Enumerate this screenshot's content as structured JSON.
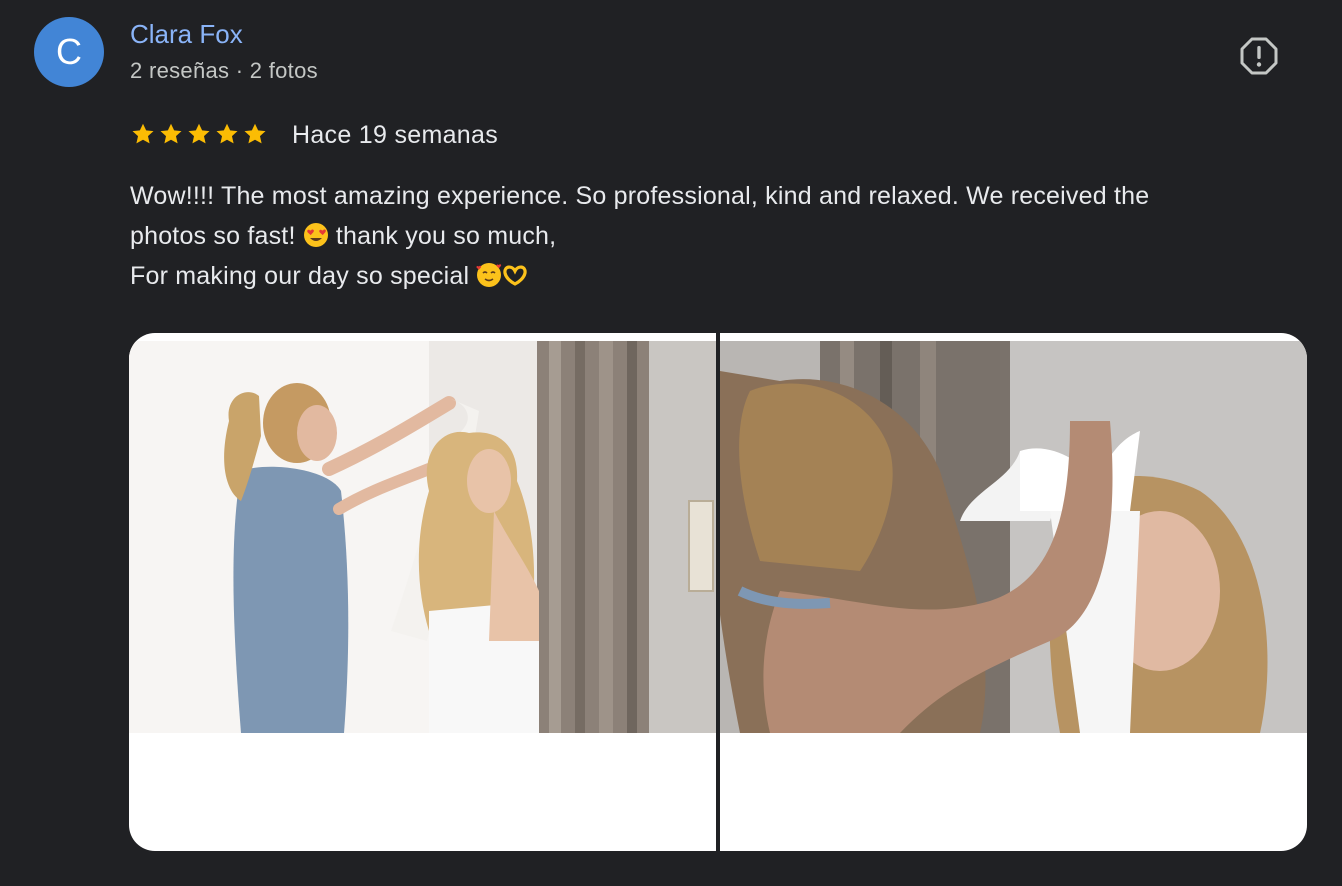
{
  "reviewer": {
    "initial": "C",
    "name": "Clara Fox",
    "meta": "2 reseñas · 2 fotos",
    "avatar_color": "#4285d6"
  },
  "rating": {
    "stars": 5,
    "max": 5,
    "star_color": "#fbbc04",
    "date": "Hace 19 semanas"
  },
  "review_text": {
    "line1": "Wow!!!! The most amazing experience. So professional, kind and relaxed. We received the",
    "line2_before": "photos so fast! ",
    "line2_emoji": "smiling-face-with-heart-eyes-icon",
    "line2_after": " thank you so much,",
    "line3": "For making our day so special ",
    "line3_emojis": [
      "smiling-face-with-hearts-icon",
      "heart-hands-icon"
    ]
  },
  "photos": [
    {
      "icon": "bride-veil-photo-1"
    },
    {
      "icon": "bride-bow-photo-2"
    }
  ],
  "actions": {
    "flag_icon": "report-flag-icon"
  }
}
